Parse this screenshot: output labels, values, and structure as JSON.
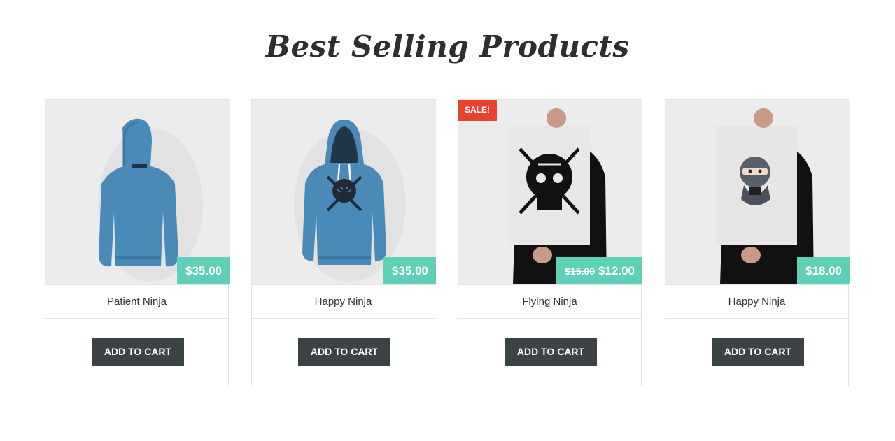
{
  "section": {
    "title": "Best Selling Products"
  },
  "products": [
    {
      "name": "Patient Ninja",
      "price": "$35.00",
      "old_price": "",
      "sale_label": "",
      "image_icon": "hoodie-back-image",
      "button_label": "ADD TO CART"
    },
    {
      "name": "Happy Ninja",
      "price": "$35.00",
      "old_price": "",
      "sale_label": "",
      "image_icon": "hoodie-front-image",
      "button_label": "ADD TO CART"
    },
    {
      "name": "Flying Ninja",
      "price": "$12.00",
      "old_price": "$15.00",
      "sale_label": "SALE!",
      "image_icon": "poster-skull-image",
      "button_label": "ADD TO CART"
    },
    {
      "name": "Happy Ninja",
      "price": "$18.00",
      "old_price": "",
      "sale_label": "",
      "image_icon": "poster-ninja-image",
      "button_label": "ADD TO CART"
    }
  ],
  "colors": {
    "price_badge": "#5fcfb6",
    "sale_badge": "#e8432e",
    "button": "#3b4344",
    "hoodie": "#4a8ab8"
  }
}
